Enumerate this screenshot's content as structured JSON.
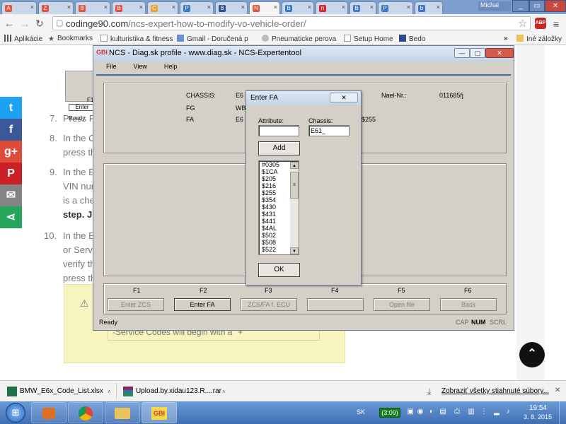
{
  "browser": {
    "tabs": [
      {
        "label": "A",
        "color": "#e5533d"
      },
      {
        "label": "Z",
        "color": "#e5533d"
      },
      {
        "label": "B",
        "color": "#e5533d"
      },
      {
        "label": "B",
        "color": "#e5533d"
      },
      {
        "label": "C",
        "color": "#f0a030"
      },
      {
        "label": "P",
        "color": "#3a78c9"
      },
      {
        "label": "B",
        "color": "#2d4f8c"
      },
      {
        "label": "N",
        "color": "#e5533d"
      },
      {
        "label": "B",
        "color": "#3a78c9"
      },
      {
        "label": "n",
        "color": "#d42b2b"
      },
      {
        "label": "B",
        "color": "#4a7bc8"
      },
      {
        "label": "P",
        "color": "#3a78c9"
      },
      {
        "label": "b",
        "color": "#3a78c9"
      }
    ],
    "user_name": "Michal",
    "url_domain": "codinge90.com",
    "url_path": "/ncs-expert-how-to-modify-vo-vehicle-order/",
    "bookmarks": {
      "apps": "Aplikácie",
      "bookmarks": "Bookmarks",
      "items": [
        "kulturistika & fitness",
        "Gmail - Doručená p",
        "Pneumaticke perova",
        "Setup Home",
        "Bedo"
      ],
      "overflow": "»",
      "other": "Iné záložky"
    }
  },
  "article": {
    "steps": [
      {
        "num": "7.",
        "text": "Press F"
      },
      {
        "num": "8.",
        "text": "In the C"
      },
      {
        "num": "",
        "text": "press th"
      },
      {
        "num": "9.",
        "text": "In the E"
      },
      {
        "num": "",
        "text": "VIN num"
      },
      {
        "num": "",
        "text": "is a che"
      },
      {
        "num": "",
        "text": "step. Ju",
        "bold": true
      },
      {
        "num": "10.",
        "text": "In the E"
      },
      {
        "num": "",
        "text": "or Servi"
      },
      {
        "num": "",
        "text": "verify th"
      },
      {
        "num": "",
        "text": "press th"
      }
    ],
    "service_note": "-Service Codes will begin with a \"+\"",
    "share_icons": [
      {
        "name": "twitter-icon",
        "glyph": "t",
        "color": "#1da1f2"
      },
      {
        "name": "facebook-icon",
        "glyph": "f",
        "color": "#3b5998"
      },
      {
        "name": "google-plus-icon",
        "glyph": "g+",
        "color": "#dd4b39"
      },
      {
        "name": "pinterest-icon",
        "glyph": "P",
        "color": "#cb2027"
      },
      {
        "name": "email-icon",
        "glyph": "✉",
        "color": "#848484"
      },
      {
        "name": "share-icon",
        "glyph": "⋖",
        "color": "#26a65b"
      }
    ]
  },
  "bg_window": {
    "label_f1": "F1",
    "label_enter": "Enter",
    "status": "Ready"
  },
  "ncs": {
    "title": "NCS - Diag.sk profile - www.diag.sk - NCS-Expertentool",
    "app_icon": "GBI",
    "menu": [
      "File",
      "View",
      "Help"
    ],
    "info": {
      "chassis_label": "CHASSIS:",
      "chassis_value": "E6",
      "fg_label": "FG",
      "fg_value": "WB",
      "fa_label": "FA",
      "fa_value": "E6",
      "fa_tail": "$255",
      "nael_label": "Nael-Nr.:",
      "nael_value": "011685fj"
    },
    "fkeys": [
      {
        "key": "F1",
        "label": "Enter ZCS",
        "enabled": false
      },
      {
        "key": "F2",
        "label": "Enter FA",
        "enabled": true
      },
      {
        "key": "F3",
        "label": "ZCS/FA f. ECU",
        "enabled": false
      },
      {
        "key": "F4",
        "label": "",
        "enabled": false
      },
      {
        "key": "F5",
        "label": "Open file",
        "enabled": false
      },
      {
        "key": "F6",
        "label": "Back",
        "enabled": false
      }
    ],
    "status": "Ready",
    "status_flags": [
      "CAP",
      "NUM",
      "SCRL"
    ]
  },
  "dialog": {
    "title": "Enter FA",
    "attribute_label": "Attribute:",
    "attribute_value": "",
    "chassis_label": "Chassis:",
    "chassis_value": "E61_",
    "add_label": "Add",
    "ok_label": "OK",
    "list_items": [
      "#0305",
      "$1CA",
      "$205",
      "$216",
      "$255",
      "$354",
      "$430",
      "$431",
      "$441",
      "$4AL",
      "$502",
      "$508",
      "$522"
    ]
  },
  "downloads": {
    "items": [
      {
        "name": "BMW_E6x_Code_List.xlsx",
        "icon_color": "#1e7145"
      },
      {
        "name": "Upload.by.xidau123.R....rar",
        "icon_color": "#8b2252"
      }
    ],
    "show_all": "Zobraziť všetky stiahnuté súbory..."
  },
  "taskbar": {
    "lang": "SK",
    "badge": "(3:09)",
    "time": "19:54",
    "date": "3. 8. 2015"
  }
}
